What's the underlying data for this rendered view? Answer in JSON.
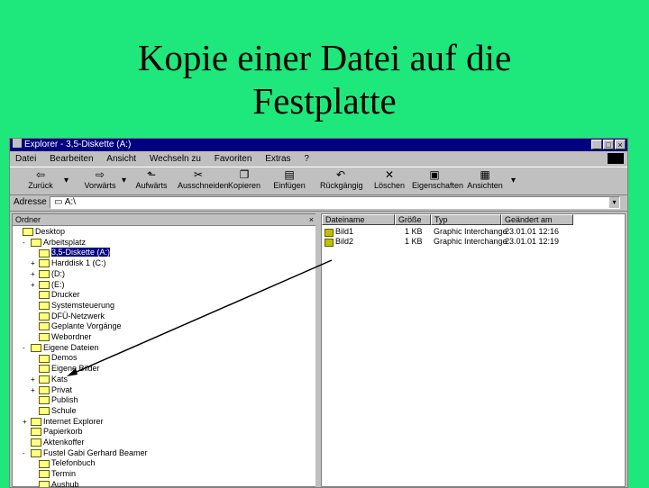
{
  "slide": {
    "title_line1": "Kopie einer Datei auf die",
    "title_line2": "Festplatte"
  },
  "window": {
    "title": "Explorer - 3,5-Diskette (A:)",
    "controls": [
      "_",
      "□",
      "×"
    ],
    "menu": [
      "Datei",
      "Bearbeiten",
      "Ansicht",
      "Wechseln zu",
      "Favoriten",
      "Extras",
      "?"
    ],
    "toolbar": [
      {
        "label": "Zurück",
        "icon": "back-arrow-icon"
      },
      {
        "label": "Vorwärts",
        "icon": "forward-arrow-icon"
      },
      {
        "label": "Aufwärts",
        "icon": "up-folder-icon"
      },
      {
        "label": "Ausschneiden",
        "icon": "scissors-icon"
      },
      {
        "label": "Kopieren",
        "icon": "copy-icon"
      },
      {
        "label": "Einfügen",
        "icon": "paste-icon"
      },
      {
        "label": "Rückgängig",
        "icon": "undo-icon"
      },
      {
        "label": "Löschen",
        "icon": "delete-icon"
      },
      {
        "label": "Eigenschaften",
        "icon": "properties-icon"
      },
      {
        "label": "Ansichten",
        "icon": "views-icon"
      }
    ],
    "address": {
      "label": "Adresse",
      "value": "A:\\"
    }
  },
  "left_pane": {
    "header": "Ordner",
    "close": "×",
    "tree": [
      {
        "pm": "",
        "label": "Desktop"
      },
      {
        "pm": "-",
        "label": "Arbeitsplatz"
      },
      {
        "pm": "",
        "label": "3,5-Diskette (A:)",
        "selected": true
      },
      {
        "pm": "+",
        "label": "Harddisk 1 (C:)"
      },
      {
        "pm": "+",
        "label": "(D:)"
      },
      {
        "pm": "+",
        "label": "(E:)"
      },
      {
        "pm": "",
        "label": "Drucker"
      },
      {
        "pm": "",
        "label": "Systemsteuerung"
      },
      {
        "pm": "",
        "label": "DFÜ-Netzwerk"
      },
      {
        "pm": "",
        "label": "Geplante Vorgänge"
      },
      {
        "pm": "",
        "label": "Webordner"
      },
      {
        "pm": "-",
        "label": "Eigene Dateien"
      },
      {
        "pm": "",
        "label": "Demos"
      },
      {
        "pm": "",
        "label": "Eigene Bilder"
      },
      {
        "pm": "+",
        "label": "Kats"
      },
      {
        "pm": "+",
        "label": "Privat"
      },
      {
        "pm": "",
        "label": "Publish"
      },
      {
        "pm": "",
        "label": "Schule"
      },
      {
        "pm": "+",
        "label": "Internet Explorer"
      },
      {
        "pm": "",
        "label": "Papierkorb"
      },
      {
        "pm": "",
        "label": "Aktenkoffer"
      },
      {
        "pm": "-",
        "label": "Fustel Gabi Gerhard Beamer"
      },
      {
        "pm": "",
        "label": "Telefonbuch"
      },
      {
        "pm": "",
        "label": "Termin"
      },
      {
        "pm": "",
        "label": "Aushub"
      }
    ]
  },
  "right_pane": {
    "columns": [
      "Dateiname",
      "Größe",
      "Typ",
      "Geändert am"
    ],
    "files": [
      {
        "name": "Bild1",
        "size": "1 KB",
        "type": "Graphic Interchange",
        "date": "23.01.01 12:16"
      },
      {
        "name": "Bild2",
        "size": "1 KB",
        "type": "Graphic Interchange",
        "date": "23.01.01 12:19"
      }
    ]
  },
  "colors": {
    "slide_bg": "#1ee87c",
    "titlebar": "#000080",
    "window_bg": "#c0c0c0"
  }
}
